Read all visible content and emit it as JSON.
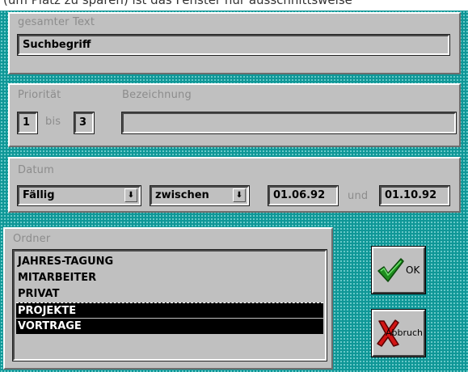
{
  "caption": "(um Platz zu sparen) ist das Fenster nur ausschnittsweise",
  "colors": {
    "dialog_bg": "#0f9797",
    "panel": "#c0c0c0",
    "label": "#8c8c8c",
    "selection": "#000000"
  },
  "text_section": {
    "label": "gesamter Text",
    "search_value": "Suchbegriff"
  },
  "priority_section": {
    "priority_label": "Priorität",
    "description_label": "Bezeichnung",
    "priority_from": "1",
    "bis_label": "bis",
    "priority_to": "3",
    "description_value": ""
  },
  "date_section": {
    "label": "Datum",
    "date_type": "Fällig",
    "range_type": "zwischen",
    "date_from": "01.06.92",
    "und_label": "und",
    "date_to": "01.10.92",
    "dropdown_icon": "down-arrow-icon"
  },
  "folder_section": {
    "label": "Ordner",
    "items": [
      {
        "label": "JAHRES-TAGUNG",
        "selected": false
      },
      {
        "label": "MITARBEITER",
        "selected": false
      },
      {
        "label": "PRIVAT",
        "selected": false
      },
      {
        "label": "PROJEKTE",
        "selected": true
      },
      {
        "label": "VORTRAGE",
        "selected": true
      }
    ]
  },
  "buttons": {
    "ok_label": "OK",
    "ok_icon": "green-checkmark-icon",
    "cancel_label": "Abbruch",
    "cancel_icon": "red-x-icon"
  }
}
